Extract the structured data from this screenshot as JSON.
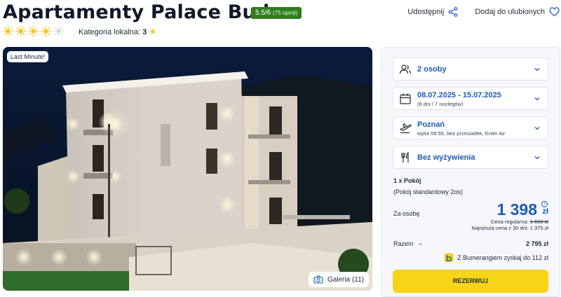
{
  "hotel": {
    "name": "Apartamenty Palace Budva",
    "rating_score": "5.5/6",
    "rating_opinions": "(75 opinii)",
    "sun_rating": 4,
    "sun_max": 5,
    "category_label": "Kategoria lokalna:",
    "category_value": "3"
  },
  "actions": {
    "share": "Udostępnij",
    "favorite": "Dodaj do ulubionych"
  },
  "photo": {
    "badge": "Last Minute!",
    "gallery": "Galeria (11)"
  },
  "booking": {
    "guests": "2 osoby",
    "dates": "08.07.2025 - 15.07.2025",
    "dates_sub": "(8 dni / 7 noclegów)",
    "departure": "Poznań",
    "departure_sub": "wylot 08:55, bez przesiadek, Enter Air",
    "board": "Bez wyżywienia",
    "room_count": "1 x Pokój",
    "room_type": "(Pokój standardowy 2os)",
    "per_person_label": "Za osobę",
    "price": "1 398",
    "currency": "zł",
    "regular_label": "Cena regularna:",
    "regular_price": "1 698 zł",
    "lowest_price_note": "Najniższa cena z 30 dni: 1 375 zł",
    "total_label": "Razem",
    "total_value": "2 795 zł",
    "bumerang": "Z Bumerangiem zyskaj do 112 zł",
    "reserve_button": "REZERWUJ"
  },
  "colors": {
    "accent_blue": "#1d5bb5",
    "rating_green": "#2f7d1f",
    "reserve_yellow": "#f7d417",
    "sun_yellow": "#f5c518"
  }
}
